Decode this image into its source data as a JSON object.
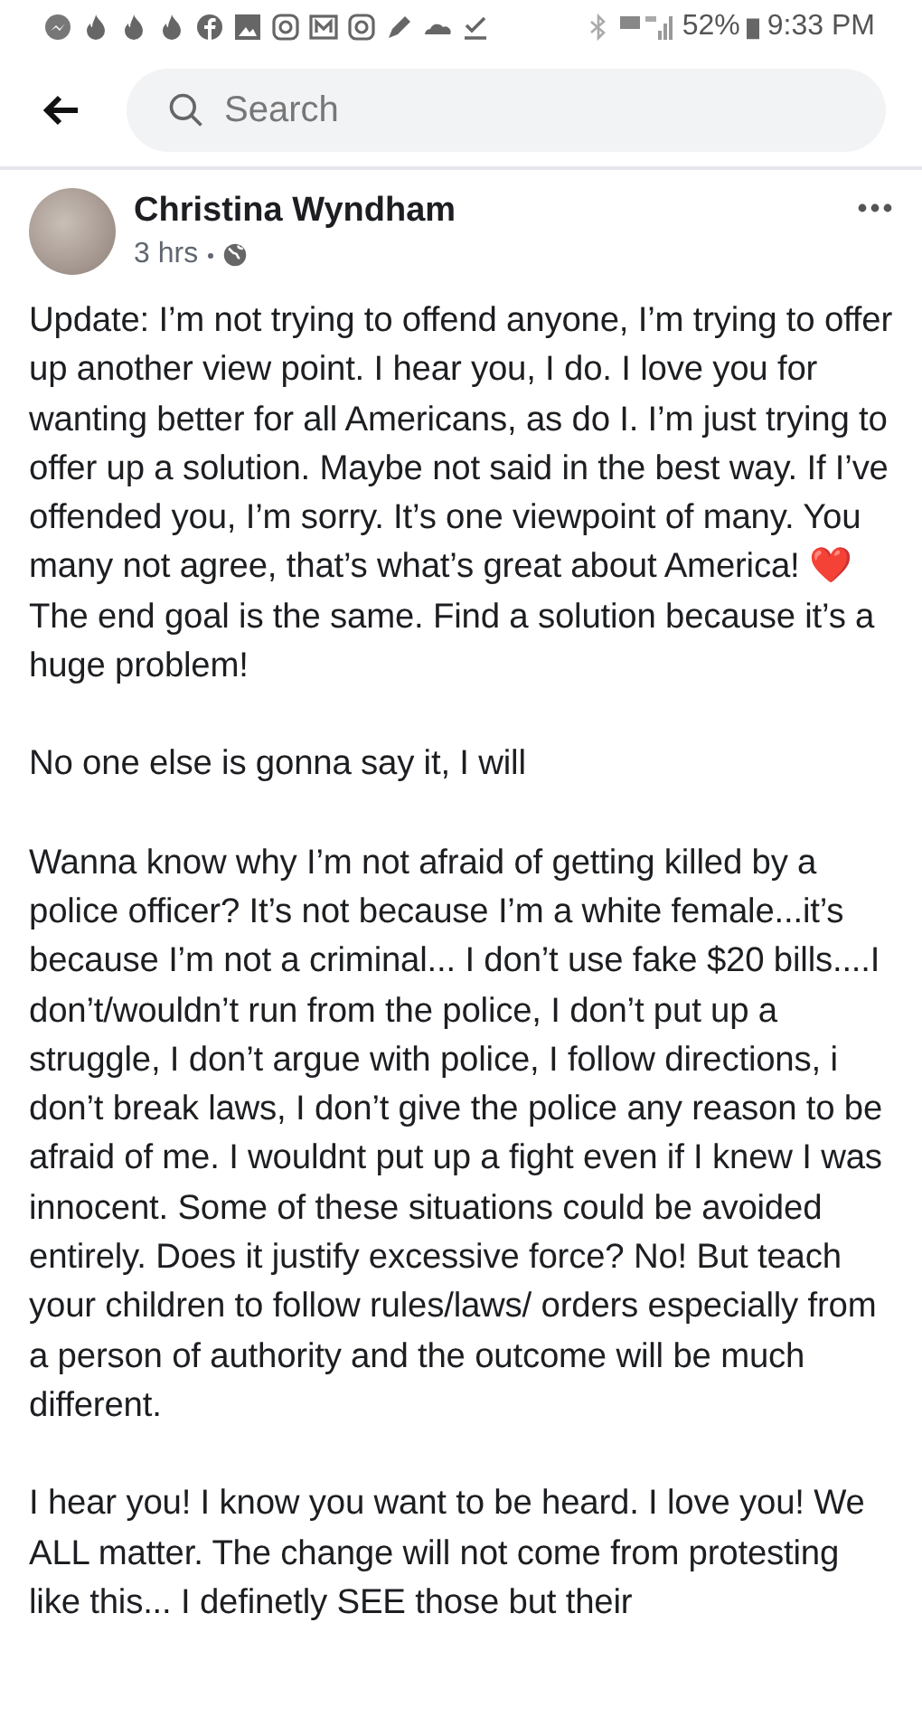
{
  "status_bar": {
    "battery": "52%",
    "time": "9:33 PM"
  },
  "search": {
    "placeholder": "Search"
  },
  "post": {
    "author": "Christina Wyndham",
    "time": "3 hrs",
    "paragraphs": [
      {
        "kind": "text",
        "text": "Update: I’m not trying to offend anyone, I’m trying to offer up another view point. I hear you, I do. I love you for wanting better for all Americans, as do I. I’m just trying to offer up a solution. Maybe not said in the best way. If I’ve offended you, I’m sorry. It’s one viewpoint of many. You many not agree, that’s what’s great about America! ❤️ The end goal is the same. Find a solution because it’s a huge problem!"
      },
      {
        "kind": "text",
        "text": "No one else is gonna say it, I will"
      },
      {
        "kind": "text",
        "text": "Wanna know why I’m not afraid of getting killed by a police officer? It’s not because I’m a white female...it’s because I’m not a criminal... I don’t use fake $20 bills....I don’t/wouldn’t  run from the police, I don’t put up a struggle, I don’t argue with police, I follow directions, i don’t break laws, I don’t give the police any reason to be afraid of me. I wouldnt put up a fight even if I knew I was innocent. Some of these situations could be avoided entirely. Does it justify excessive force? No! But teach your children to follow rules/laws/ orders especially from a person of authority and the outcome will be much different."
      },
      {
        "kind": "text",
        "text": "I hear you! I know you want to be heard. I love you! We ALL matter. The change will not come from protesting like this... I definetly SEE those but their"
      }
    ]
  }
}
